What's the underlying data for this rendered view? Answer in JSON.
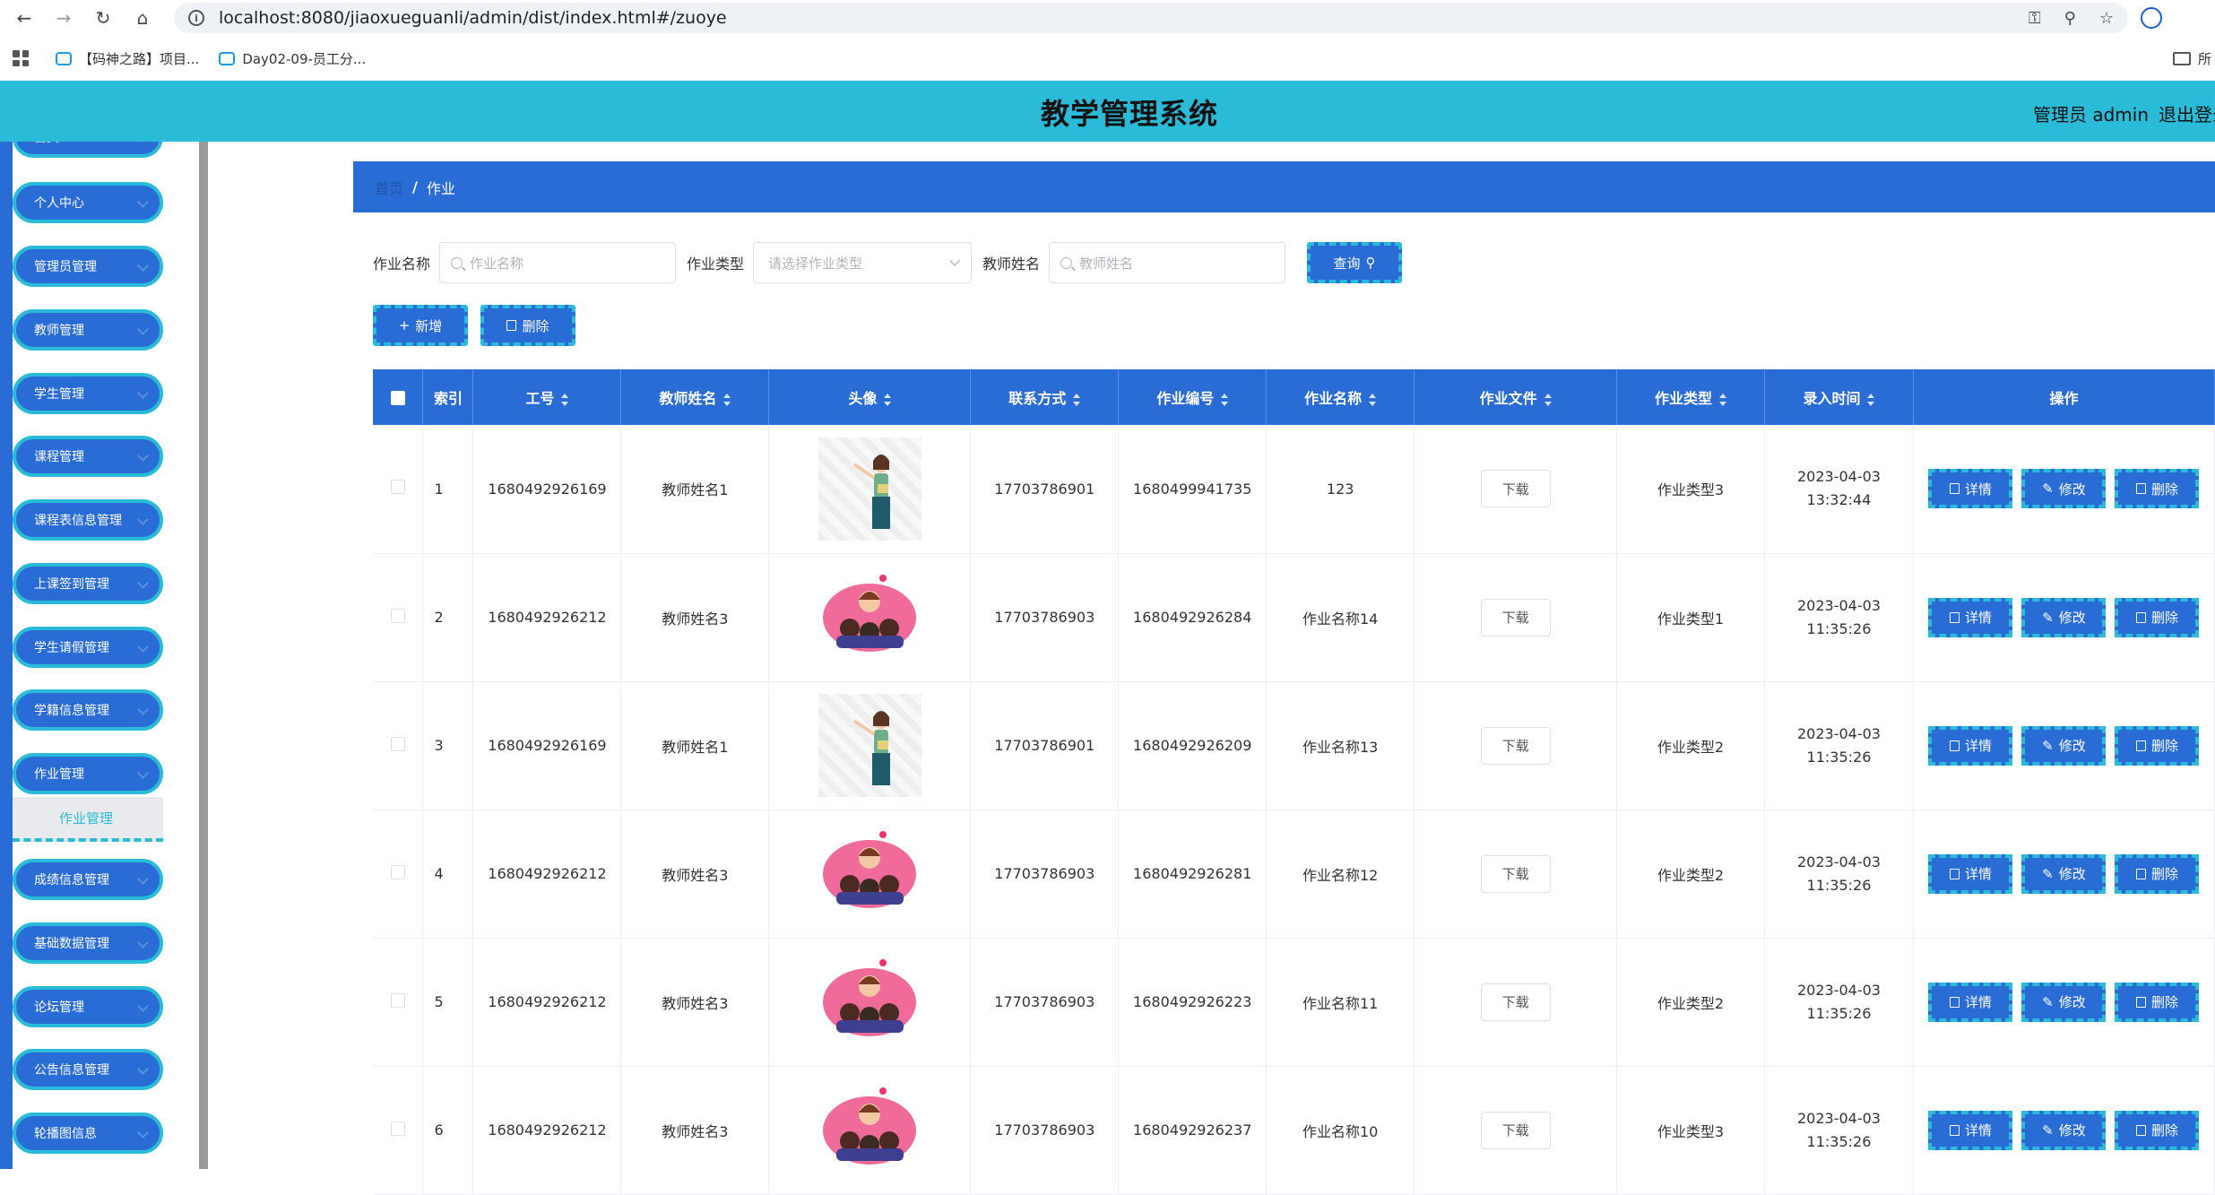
{
  "browser": {
    "url": "localhost:8080/jiaoxueguanli/admin/dist/index.html#/zuoye",
    "bookmarks": [
      "【码神之路】项目...",
      "Day02-09-员工分..."
    ],
    "bookmark_right": "所"
  },
  "header": {
    "title": "教学管理系统",
    "user": "管理员 admin",
    "logout": "退出登录"
  },
  "sidebar": {
    "top_item": "首页",
    "items": [
      "个人中心",
      "管理员管理",
      "教师管理",
      "学生管理",
      "课程管理",
      "课程表信息管理",
      "上课签到管理",
      "学生请假管理",
      "学籍信息管理",
      "作业管理",
      "成绩信息管理",
      "基础数据管理",
      "论坛管理",
      "公告信息管理",
      "轮播图信息"
    ],
    "active_sub": "作业管理"
  },
  "breadcrumb": {
    "home": "首页",
    "current": "作业"
  },
  "search": {
    "name_label": "作业名称",
    "name_placeholder": "作业名称",
    "type_label": "作业类型",
    "type_placeholder": "请选择作业类型",
    "teacher_label": "教师姓名",
    "teacher_placeholder": "教师姓名",
    "query_button": "查询"
  },
  "toolbar": {
    "add": "新增",
    "delete": "删除"
  },
  "table": {
    "headers": [
      "索引",
      "工号",
      "教师姓名",
      "头像",
      "联系方式",
      "作业编号",
      "作业名称",
      "作业文件",
      "作业类型",
      "录入时间",
      "操作"
    ],
    "download_label": "下载",
    "ops": [
      "详情",
      "修改",
      "删除"
    ],
    "rows": [
      {
        "idx": "1",
        "job_no": "1680492926169",
        "teacher": "教师姓名1",
        "avatar": "teacher",
        "phone": "17703786901",
        "hw_no": "1680499941735",
        "hw_name": "123",
        "hw_type": "作业类型3",
        "time": "2023-04-03 13:32:44"
      },
      {
        "idx": "2",
        "job_no": "1680492926212",
        "teacher": "教师姓名3",
        "avatar": "group",
        "phone": "17703786903",
        "hw_no": "1680492926284",
        "hw_name": "作业名称14",
        "hw_type": "作业类型1",
        "time": "2023-04-03 11:35:26"
      },
      {
        "idx": "3",
        "job_no": "1680492926169",
        "teacher": "教师姓名1",
        "avatar": "teacher",
        "phone": "17703786901",
        "hw_no": "1680492926209",
        "hw_name": "作业名称13",
        "hw_type": "作业类型2",
        "time": "2023-04-03 11:35:26"
      },
      {
        "idx": "4",
        "job_no": "1680492926212",
        "teacher": "教师姓名3",
        "avatar": "group",
        "phone": "17703786903",
        "hw_no": "1680492926281",
        "hw_name": "作业名称12",
        "hw_type": "作业类型2",
        "time": "2023-04-03 11:35:26"
      },
      {
        "idx": "5",
        "job_no": "1680492926212",
        "teacher": "教师姓名3",
        "avatar": "group",
        "phone": "17703786903",
        "hw_no": "1680492926223",
        "hw_name": "作业名称11",
        "hw_type": "作业类型2",
        "time": "2023-04-03 11:35:26"
      },
      {
        "idx": "6",
        "job_no": "1680492926212",
        "teacher": "教师姓名3",
        "avatar": "group",
        "phone": "17703786903",
        "hw_no": "1680492926237",
        "hw_name": "作业名称10",
        "hw_type": "作业类型3",
        "time": "2023-04-03 11:35:26"
      }
    ]
  },
  "colors": {
    "header": "#29bbd8",
    "primary": "#2a6cd6",
    "accent_border": "#29bbd8"
  }
}
